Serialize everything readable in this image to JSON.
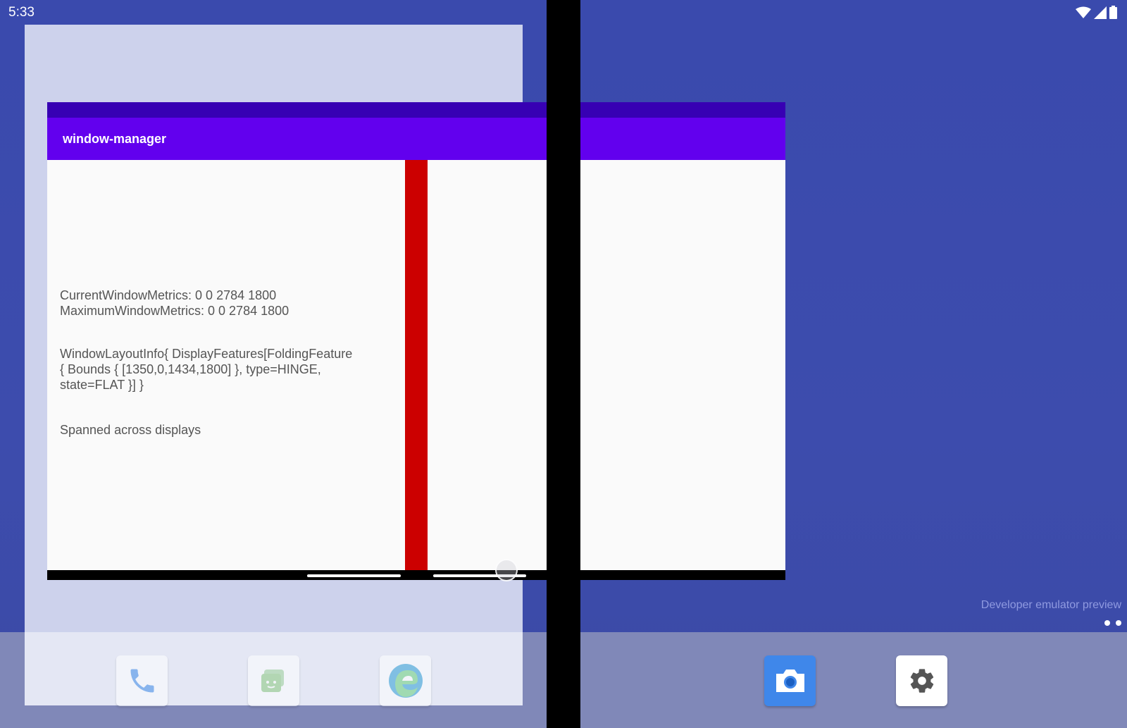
{
  "status_bar": {
    "time": "5:33",
    "icons": [
      "wifi-icon",
      "cellular-signal-icon",
      "battery-icon"
    ]
  },
  "app": {
    "title": "window-manager",
    "colors": {
      "status": "#3700b3",
      "toolbar": "#6200ee",
      "fold": "#cc0000"
    },
    "lines": {
      "current_metrics": "CurrentWindowMetrics: 0 0 2784 1800",
      "maximum_metrics": "MaximumWindowMetrics: 0 0 2784 1800",
      "layout_line1": "WindowLayoutInfo{ DisplayFeatures[FoldingFeature",
      "layout_line2": "{ Bounds { [1350,0,1434,1800] }, type=HINGE,",
      "layout_line3": "state=FLAT }] }",
      "span_status": "Spanned across displays"
    }
  },
  "desktop": {
    "watermark": "Developer emulator preview",
    "page_count": 2,
    "dock_apps": [
      {
        "name": "Phone",
        "icon": "phone-icon"
      },
      {
        "name": "Messages",
        "icon": "messages-icon"
      },
      {
        "name": "Edge",
        "icon": "edge-browser-icon"
      },
      {
        "name": "Camera",
        "icon": "camera-icon"
      },
      {
        "name": "Settings",
        "icon": "settings-gear-icon"
      }
    ]
  }
}
